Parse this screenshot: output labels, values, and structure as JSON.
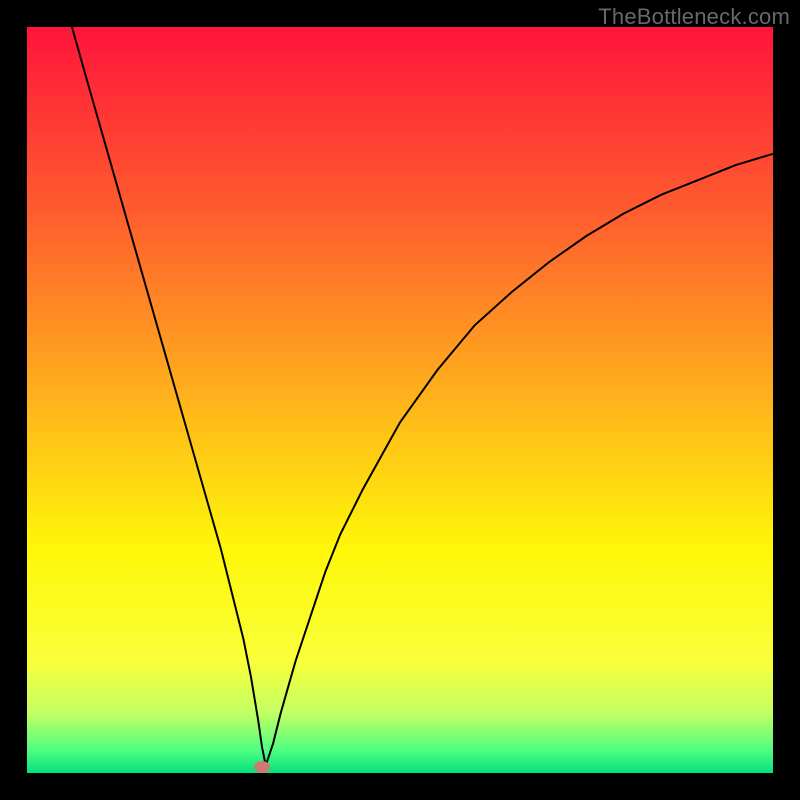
{
  "watermark": "TheBottleneck.com",
  "chart_data": {
    "type": "line",
    "title": "",
    "xlabel": "",
    "ylabel": "",
    "xlim": [
      0,
      100
    ],
    "ylim": [
      0,
      100
    ],
    "legend": false,
    "grid": false,
    "background_gradient": {
      "direction": "vertical",
      "stops": [
        {
          "pos": 0.0,
          "color": "#ff153b"
        },
        {
          "pos": 0.25,
          "color": "#ff5d2e"
        },
        {
          "pos": 0.5,
          "color": "#ffb31b"
        },
        {
          "pos": 0.7,
          "color": "#fef708"
        },
        {
          "pos": 0.85,
          "color": "#f9ff3a"
        },
        {
          "pos": 0.92,
          "color": "#c1ff63"
        },
        {
          "pos": 0.97,
          "color": "#4dfe81"
        },
        {
          "pos": 1.0,
          "color": "#04e080"
        }
      ]
    },
    "series": [
      {
        "name": "bottleneck-curve",
        "color": "#000000",
        "width": 2,
        "x": [
          6,
          8,
          10,
          12,
          14,
          16,
          18,
          20,
          22,
          24,
          26,
          28,
          29,
          30,
          31,
          31.5,
          32,
          33,
          34,
          36,
          38,
          40,
          42,
          45,
          50,
          55,
          60,
          65,
          70,
          75,
          80,
          85,
          90,
          95,
          100
        ],
        "y": [
          100.1,
          93,
          86,
          79,
          72,
          65,
          58,
          51,
          44,
          37,
          30,
          22,
          18,
          13,
          7,
          3.5,
          1,
          4,
          8,
          15,
          21,
          27,
          32,
          38,
          47,
          54,
          60,
          64.5,
          68.5,
          72,
          75,
          77.5,
          79.5,
          81.5,
          83
        ]
      }
    ],
    "marker": {
      "x": 31.5,
      "y": 0.8,
      "color": "#cf7a6f",
      "rx": 8,
      "ry": 6
    }
  }
}
